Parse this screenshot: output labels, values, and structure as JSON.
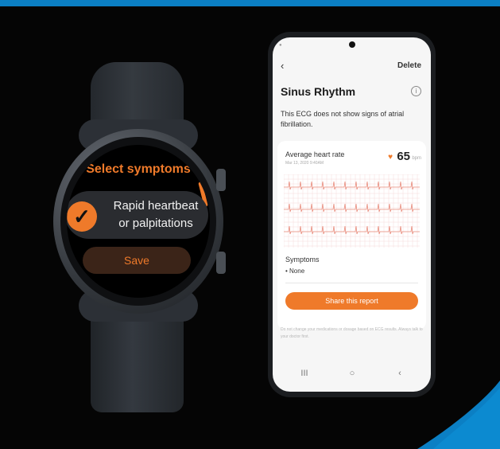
{
  "watch": {
    "title": "Select symptoms",
    "option_line1": "Rapid heartbeat",
    "option_line2": "or palpitations",
    "save_label": "Save",
    "check_icon": "✓"
  },
  "phone": {
    "back_icon": "‹",
    "delete_label": "Delete",
    "result_title": "Sinus Rhythm",
    "info_icon": "i",
    "result_description": "This ECG does not show signs of atrial fibrillation.",
    "avg_hr_label": "Average heart rate",
    "avg_hr_date": "Mar 13, 2020 9:40AM",
    "heart_icon": "♥",
    "bpm_value": "65",
    "bpm_unit": "bpm",
    "symptoms_label": "Symptoms",
    "symptoms_value": "• None",
    "share_label": "Share this report",
    "disclaimer": "Do not change your medications or dosage based on ECG results. Always talk to your doctor first.",
    "nav": [
      "III",
      "○",
      "‹"
    ]
  },
  "colors": {
    "accent": "#ef7a2a",
    "top_bar": "#0b7fc4",
    "corner": "#0b7fc4"
  }
}
